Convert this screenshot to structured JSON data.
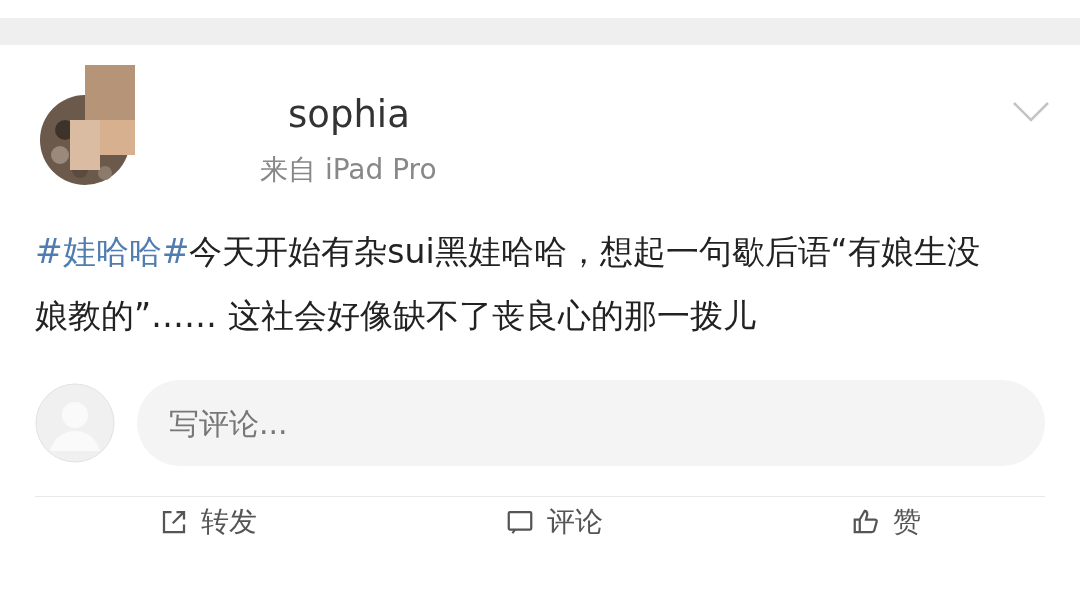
{
  "post": {
    "author": "sophia",
    "source": "来自 iPad Pro",
    "hashtag": "#娃哈哈#",
    "text": "今天开始有杂sui黑娃哈哈，想起一句歇后语“有娘生没娘教的”…… 这社会好像缺不了丧良心的那一拨儿"
  },
  "comment_box": {
    "placeholder": "写评论..."
  },
  "actions": [
    {
      "kind": "repost",
      "label": "转发"
    },
    {
      "kind": "comment",
      "label": "评论"
    },
    {
      "kind": "like",
      "label": "赞"
    }
  ]
}
